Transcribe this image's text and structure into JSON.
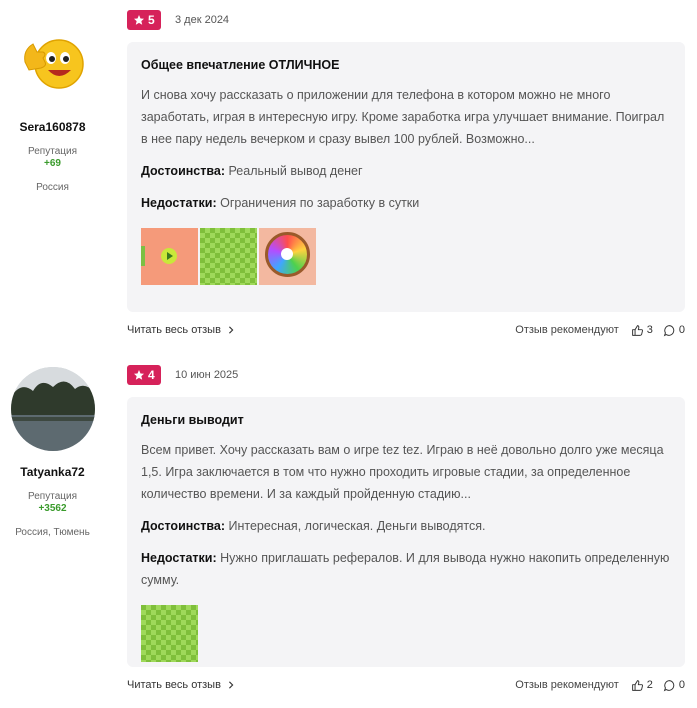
{
  "reviews": [
    {
      "rating": "5",
      "date": "3 дек 2024",
      "author": {
        "name": "Sera160878",
        "rep_label": "Репутация",
        "rep_value": "+69",
        "location": "Россия"
      },
      "title": "Общее впечатление ОТЛИЧНОЕ",
      "text": "И снова хочу рассказать о приложении для телефона в котором можно не много заработать, играя в интересную игру. Кроме заработка игра улучшает внимание. Поиграл в нее пару недель вечерком и сразу вывел 100 рублей. Возможно...",
      "pros_label": "Достоинства:",
      "pros": "Реальный вывод денег",
      "cons_label": "Недостатки:",
      "cons": "Ограничения по заработку в сутки",
      "read_more": "Читать весь отзыв",
      "recommend": "Отзыв рекомендуют",
      "likes": "3",
      "comments": "0"
    },
    {
      "rating": "4",
      "date": "10 июн 2025",
      "author": {
        "name": "Tatyanka72",
        "rep_label": "Репутация",
        "rep_value": "+3562",
        "location": "Россия, Тюмень"
      },
      "title": "Деньги выводит",
      "text": "Всем привет. Хочу рассказать вам о игре tez tez. Играю в неё довольно долго уже месяца 1,5. Игра заключается в том что нужно проходить игровые стадии, за определенное количество времени. И за каждый пройденную стадию...",
      "pros_label": "Достоинства:",
      "pros": "Интересная, логическая. Деньги выводятся.",
      "cons_label": "Недостатки:",
      "cons": "Нужно приглашать рефералов. И для вывода нужно накопить определенную сумму.",
      "read_more": "Читать весь отзыв",
      "recommend": "Отзыв рекомендуют",
      "likes": "2",
      "comments": "0"
    }
  ],
  "colors": {
    "rating_badge": "#d6225a",
    "reputation": "#3a9b2c",
    "card_bg": "#f4f4f6"
  }
}
